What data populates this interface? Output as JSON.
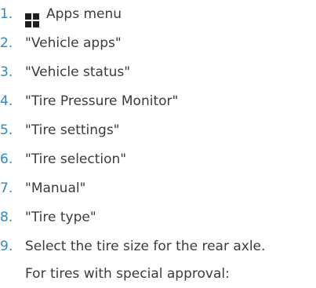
{
  "steps": [
    {
      "number": "1.",
      "icon": "apps-grid-icon",
      "text": "Apps menu"
    },
    {
      "number": "2.",
      "text": "\"Vehicle apps\""
    },
    {
      "number": "3.",
      "text": "\"Vehicle status\""
    },
    {
      "number": "4.",
      "text": "\"Tire Pressure Monitor\""
    },
    {
      "number": "5.",
      "text": "\"Tire settings\""
    },
    {
      "number": "6.",
      "text": "\"Tire selection\""
    },
    {
      "number": "7.",
      "text": "\"Manual\""
    },
    {
      "number": "8.",
      "text": "\"Tire type\""
    },
    {
      "number": "9.",
      "text": "Select the tire size for the rear axle.",
      "text_line2": "For tires with special approval:"
    }
  ],
  "colors": {
    "number": "#2f86c4",
    "text": "#3b3b3b",
    "icon": "#1f1f1f"
  }
}
